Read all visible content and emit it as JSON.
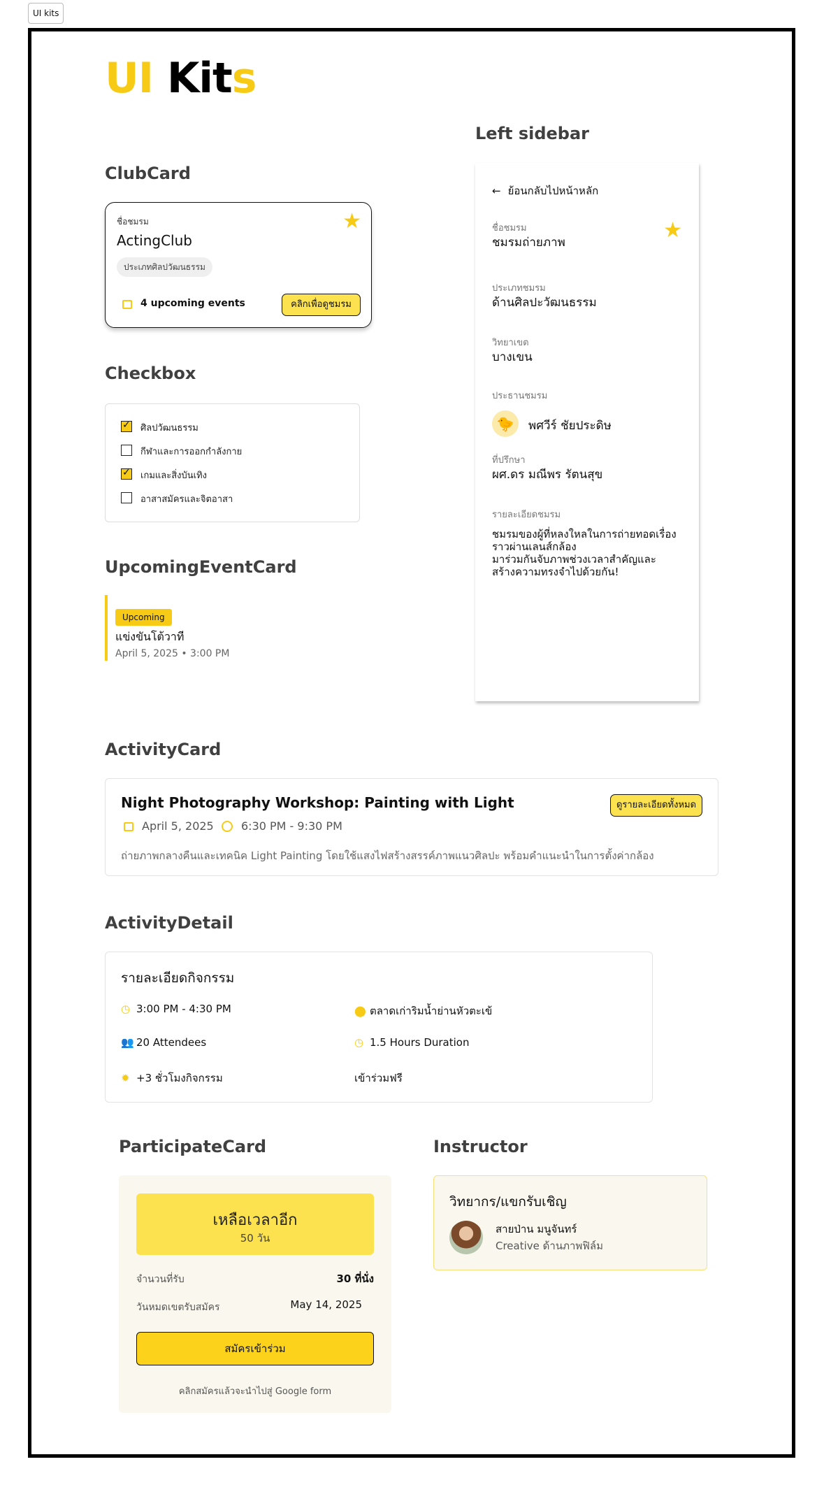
{
  "chip_label": "UI kits",
  "title": {
    "part1": "UI",
    "part2": "Kit",
    "part3": "s"
  },
  "sections": {
    "club_card": "ClubCard",
    "checkbox": "Checkbox",
    "upcoming": "UpcomingEventCard",
    "sidebar": "Left sidebar",
    "activity_card": "ActivityCard",
    "activity_detail": "ActivityDetail",
    "participate": "ParticipateCard",
    "instructor": "Instructor"
  },
  "club_card": {
    "label": "ชื่อชมรม",
    "name": "ActingClub",
    "category": "ประเภทศิลปวัฒนธรรม",
    "events": "4 upcoming events",
    "button": "คลิกเพื่อดูชมรม"
  },
  "checkbox": {
    "items": [
      {
        "label": "ศิลปวัฒนธรรม",
        "checked": true
      },
      {
        "label": "กีฬาและการออกกำลังกาย",
        "checked": false
      },
      {
        "label": "เกมและสิ่งบันเทิง",
        "checked": true
      },
      {
        "label": "อาสาสมัครและจิตอาสา",
        "checked": false
      }
    ]
  },
  "upcoming_event": {
    "badge": "Upcoming",
    "title": "แข่งขันโต้วาที",
    "date": "April 5, 2025 • 3:00 PM"
  },
  "sidebar": {
    "back": "ย้อนกลับไปหน้าหลัก",
    "club_label": "ชื่อชมรม",
    "club_value": "ชมรมถ่ายภาพ",
    "type_label": "ประเภทชมรม",
    "type_value": "ด้านศิลปะวัฒนธรรม",
    "campus_label": "วิทยาเขต",
    "campus_value": "บางเขน",
    "president_label": "ประธานชมรม",
    "president_value": "พศวีร์ ชัยประดิษ",
    "advisor_label": "ที่ปรึกษา",
    "advisor_value": "ผศ.ดร มณีพร รัตนสุข",
    "detail_label": "รายละเอียดชมรม",
    "detail_lines": [
      "ชมรมของผู้ที่หลงใหลในการถ่ายทอดเรื่อง",
      "ราวผ่านเลนส์กล้อง",
      "มาร่วมกันจับภาพช่วงเวลาสำคัญและ",
      "สร้างความทรงจำไปด้วยกัน!"
    ]
  },
  "activity_card": {
    "title": "Night Photography Workshop: Painting with Light",
    "button": "ดูรายละเอียดทั้งหมด",
    "date": "April 5, 2025",
    "time": "6:30 PM - 9:30 PM",
    "description": "ถ่ายภาพกลางคืนและเทคนิค Light Painting โดยใช้แสงไฟสร้างสรรค์ภาพแนวศิลปะ พร้อมคำแนะนำในการตั้งค่ากล้อง"
  },
  "activity_detail": {
    "title": "รายละเอียดกิจกรรม",
    "time": "3:00 PM - 4:30 PM",
    "location": "ตลาดเก่าริมน้ำย่านหัวตะเข้",
    "attendees": "20 Attendees",
    "duration": "1.5 Hours Duration",
    "hours": "+3 ชั่วโมงกิจกรรม",
    "fee": "เข้าร่วมฟรี"
  },
  "participate": {
    "hero_title": "เหลือเวลาอีก",
    "hero_sub": "50 วัน",
    "seats_label": "จำนวนที่รับ",
    "seats_value": "30 ที่นั่ง",
    "deadline_label": "วันหมดเขตรับสมัคร",
    "deadline_value": "May 14, 2025",
    "cta": "สมัครเข้าร่วม",
    "note": "คลิกสมัครแล้วจะนำไปสู่ Google form"
  },
  "instructor": {
    "title": "วิทยากร/แขกรับเชิญ",
    "name": "สายป่าน มนูจันทร์",
    "role": "Creative ด้านภาพฟิล์ม"
  },
  "colors": {
    "accent": "#f7cb15",
    "button": "#fde24f",
    "panel": "#faf8ee"
  }
}
